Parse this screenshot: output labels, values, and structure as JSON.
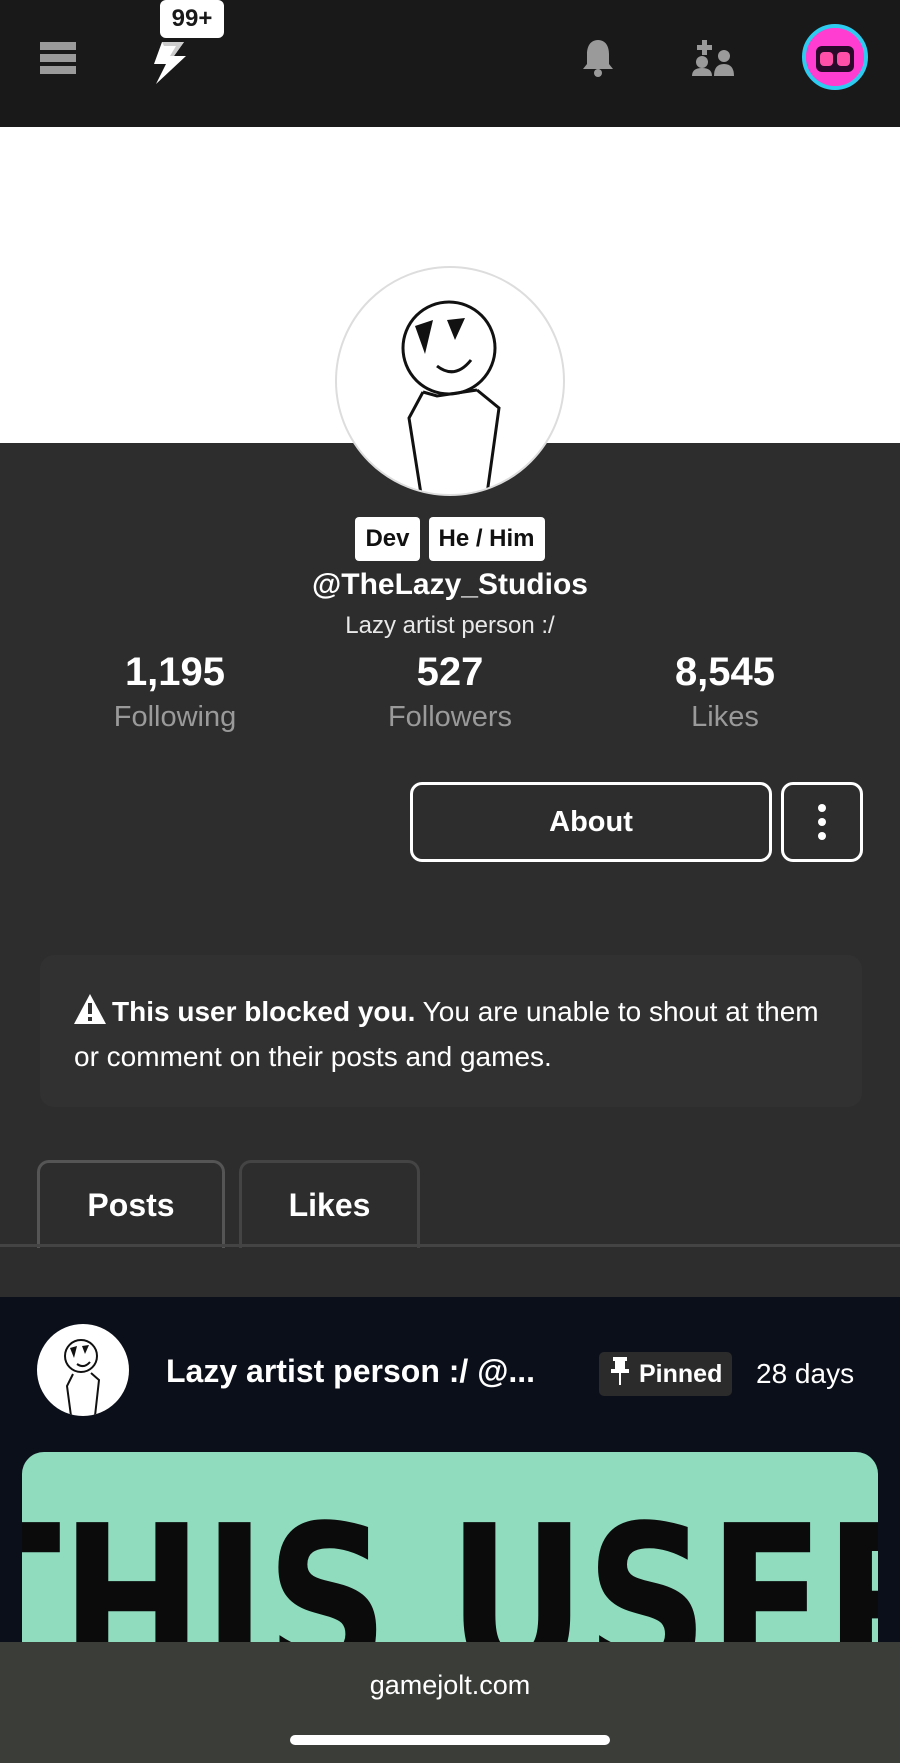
{
  "topbar": {
    "notification_badge": "99+"
  },
  "profile": {
    "tags": [
      "Dev",
      "He / Him"
    ],
    "username": "@TheLazy_Studios",
    "bio": "Lazy artist person :/",
    "stats": [
      {
        "value": "1,195",
        "label": "Following"
      },
      {
        "value": "527",
        "label": "Followers"
      },
      {
        "value": "8,545",
        "label": "Likes"
      }
    ],
    "about_label": "About"
  },
  "blocked_notice": {
    "bold": "This user blocked you.",
    "text": " You are unable to shout at them or comment on their posts and games."
  },
  "tabs": [
    {
      "label": "Posts",
      "active": true
    },
    {
      "label": "Likes",
      "active": false
    }
  ],
  "post": {
    "title": "Lazy artist person :/ @...",
    "pinned_label": "Pinned",
    "time": "28 days",
    "image_text": "THIS USER"
  },
  "browser": {
    "url": "gamejolt.com"
  },
  "colors": {
    "background": "#2d2d2d",
    "topbar": "#191919",
    "post_image": "#8fdcbf",
    "avatar_accent": "#ff3dd1"
  }
}
